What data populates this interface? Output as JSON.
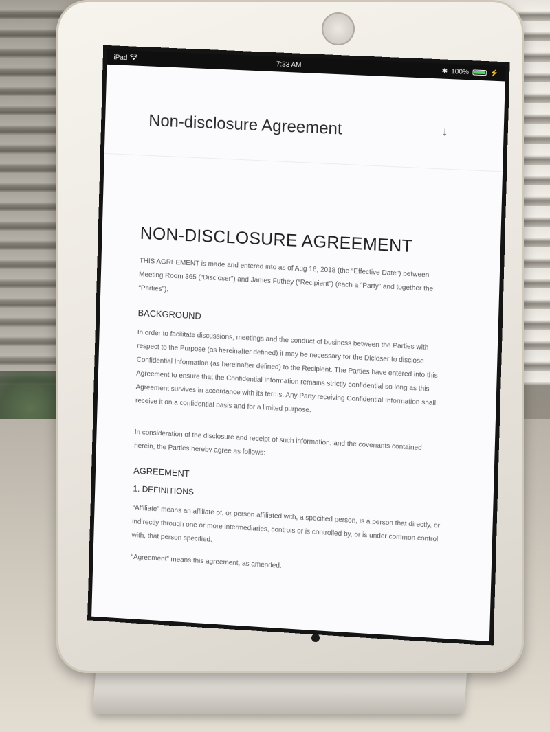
{
  "status_bar": {
    "device": "iPad",
    "time": "7:33 AM",
    "battery": "100%",
    "battery_level": 1.0,
    "icons": [
      "wifi-icon",
      "bluetooth-icon",
      "battery-icon",
      "charging-icon"
    ]
  },
  "document": {
    "app_title": "Non-disclosure Agreement",
    "download_icon": "download-arrow-icon",
    "heading": "NON-DISCLOSURE AGREEMENT",
    "intro": "THIS AGREEMENT is made and entered into as of Aug 16, 2018 (the “Effective Date”) between Meeting Room 365 (“Discloser”) and James Futhey (“Recipient”) (each a “Party” and together the “Parties”).",
    "background_heading": "BACKGROUND",
    "background_text": "In order to facilitate discussions, meetings and the conduct of business between the Parties with respect to the Purpose (as hereinafter defined) it may be necessary for the Dicloser to disclose Confidential Information (as hereinafter defined) to the Recipient. The Parties have entered into this Agreement to ensure that the Confidential Information remains strictly confidential so long as this Agreement survives in accordance with its terms. Any Party receiving Confidential Information shall receive it on a confidential basis and for a limited purpose.",
    "consideration_text": "In consideration of the disclosure and receipt of such information, and the covenants contained herein, the Parties hereby agree as follows:",
    "agreement_heading": "AGREEMENT",
    "definitions_heading": "1. DEFINITIONS",
    "affiliate_text": "“Affiliate” means an affiliate of, or person affiliated with, a specified person, is a person that directly, or indirectly through one or more intermediaries, controls or is controlled by, or is under common control with, that person specified.",
    "agreement_def_text": "“Agreement” means this agreement, as amended."
  }
}
